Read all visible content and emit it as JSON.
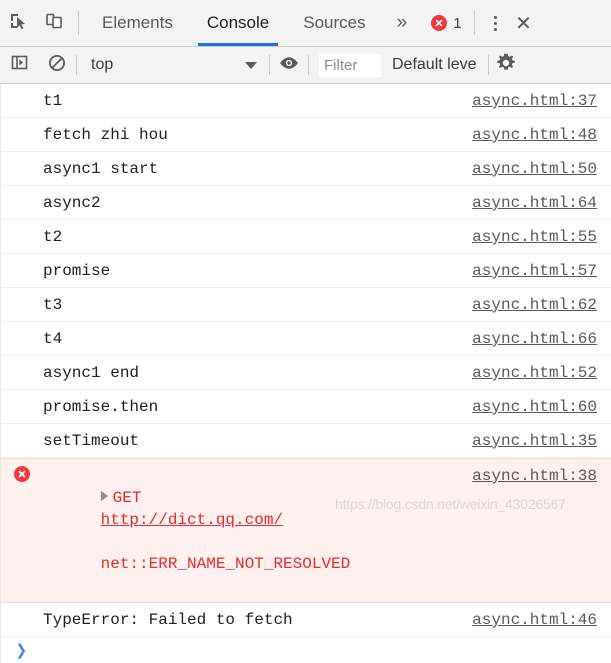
{
  "tabbar": {
    "inspect_icon": "inspect-element-icon",
    "device_icon": "device-toolbar-icon",
    "tabs": [
      {
        "label": "Elements",
        "active": false
      },
      {
        "label": "Console",
        "active": true
      },
      {
        "label": "Sources",
        "active": false
      }
    ],
    "overflow_label": "»",
    "error_count": "1",
    "error_icon": "error-circle-icon",
    "more_options_icon": "more-options-icon",
    "close_label": "✕",
    "accent_color": "#1a73e8",
    "error_color": "#ee3b3b"
  },
  "filterbar": {
    "sidebar_toggle_icon": "console-sidebar-icon",
    "clear_icon": "clear-console-icon",
    "context_value": "top",
    "context_caret_icon": "chevron-down-icon",
    "eye_icon": "live-expression-eye-icon",
    "filter_placeholder": "Filter",
    "filter_value": "",
    "levels_label": "Default leve",
    "settings_icon": "settings-gear-icon"
  },
  "console": {
    "messages": [
      {
        "text": "t1",
        "source": "async.html:37",
        "level": "log"
      },
      {
        "text": "fetch zhi hou",
        "source": "async.html:48",
        "level": "log"
      },
      {
        "text": "async1 start",
        "source": "async.html:50",
        "level": "log"
      },
      {
        "text": "async2",
        "source": "async.html:64",
        "level": "log"
      },
      {
        "text": "t2",
        "source": "async.html:55",
        "level": "log"
      },
      {
        "text": "promise",
        "source": "async.html:57",
        "level": "log"
      },
      {
        "text": "t3",
        "source": "async.html:62",
        "level": "log"
      },
      {
        "text": "t4",
        "source": "async.html:66",
        "level": "log"
      },
      {
        "text": "async1 end",
        "source": "async.html:52",
        "level": "log"
      },
      {
        "text": "promise.then",
        "source": "async.html:60",
        "level": "log"
      },
      {
        "text": "setTimeout",
        "source": "async.html:35",
        "level": "log"
      }
    ],
    "error_message": {
      "method": "GET",
      "url": "http://dict.qq.com/",
      "detail": "net::ERR_NAME_NOT_RESOLVED",
      "source": "async.html:38",
      "icon": "error-circle-icon",
      "expander_icon": "disclosure-triangle-icon"
    },
    "type_error": {
      "text": "TypeError: Failed to fetch",
      "source": "async.html:46"
    }
  },
  "prompt": {
    "chevron": "❯"
  },
  "watermark": {
    "text": "https://blog.csdn.net/weixin_43026567"
  }
}
